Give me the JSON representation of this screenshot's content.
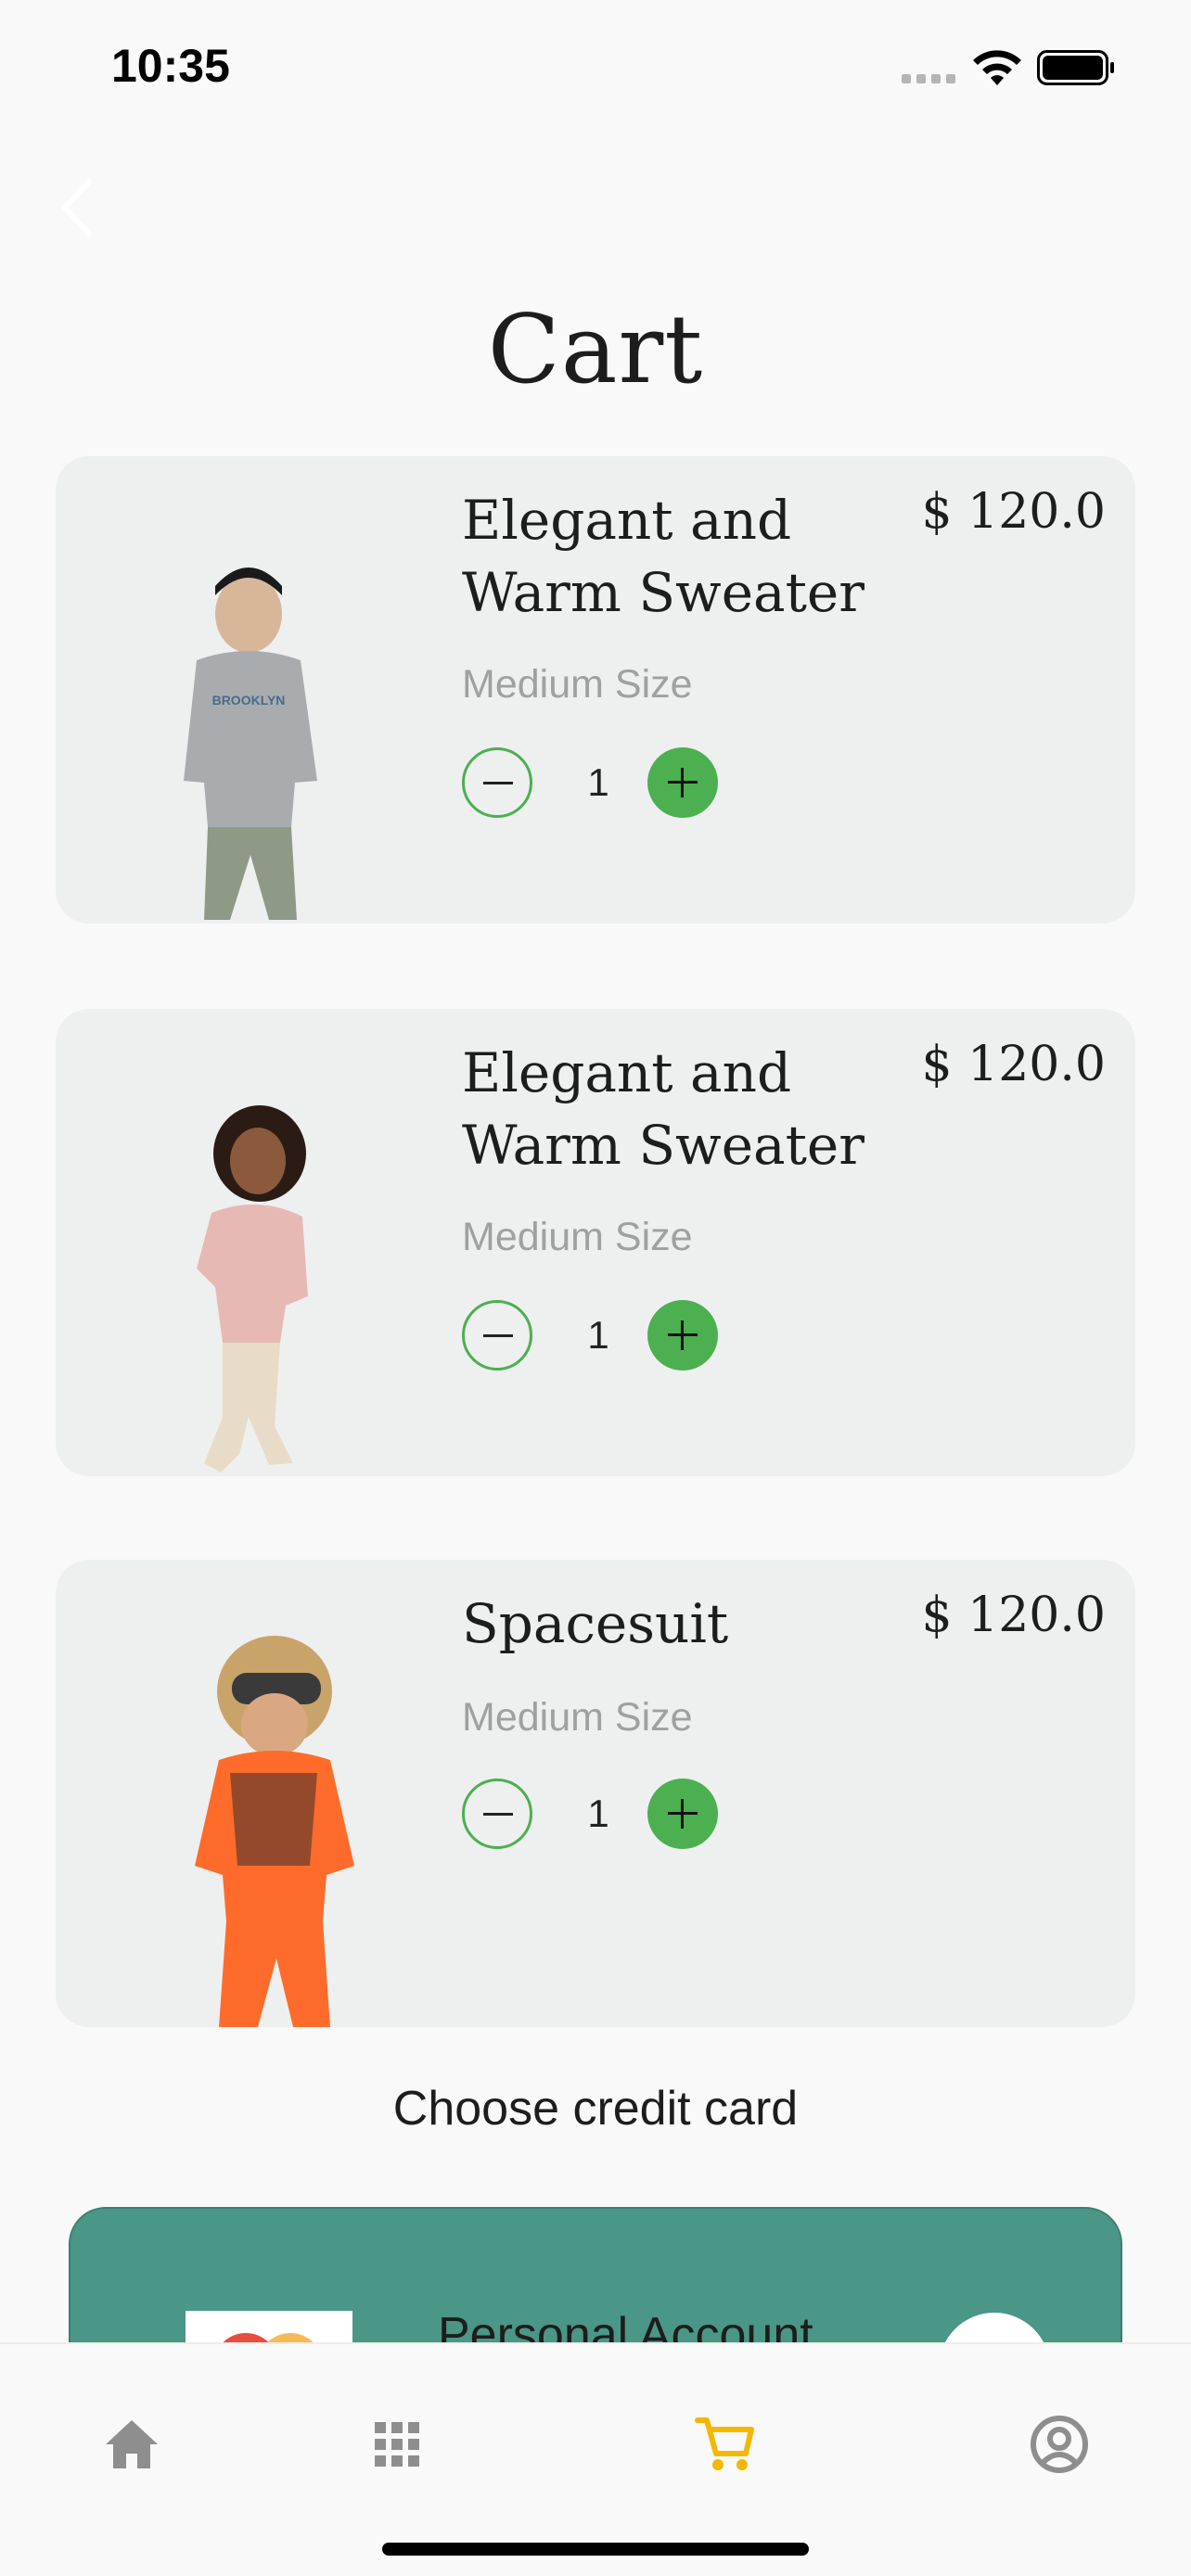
{
  "status_bar": {
    "time": "10:35"
  },
  "header": {
    "title": "Cart"
  },
  "cart_items": [
    {
      "title": "Elegant and Warm Sweater",
      "price": "$ 120.0",
      "size": "Medium Size",
      "quantity": "1"
    },
    {
      "title": "Elegant and Warm Sweater",
      "price": "$ 120.0",
      "size": "Medium Size",
      "quantity": "1"
    },
    {
      "title": "Spacesuit",
      "price": "$ 120.0",
      "size": "Medium Size",
      "quantity": "1"
    }
  ],
  "payment": {
    "section_label": "Choose credit card",
    "card_account": "Personal Account",
    "card_color": "#4a9687"
  },
  "bottom_nav": {
    "items": [
      {
        "icon": "home-icon",
        "active": false
      },
      {
        "icon": "grid-icon",
        "active": false
      },
      {
        "icon": "cart-icon",
        "active": true
      },
      {
        "icon": "profile-icon",
        "active": false
      }
    ],
    "active_color": "#f5b800",
    "inactive_color": "#8e8e8e"
  },
  "accent": {
    "green": "#4caf50"
  }
}
